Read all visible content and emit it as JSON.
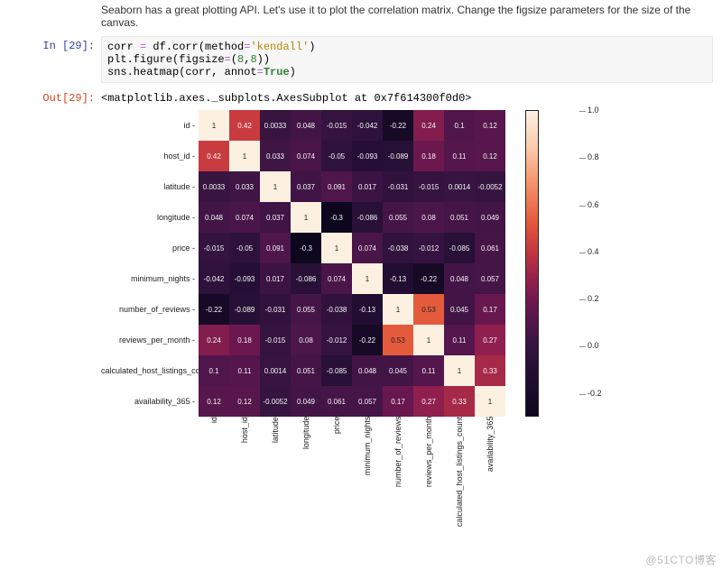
{
  "description": "Seaborn has a great plotting API. Let's use it to plot the correlation matrix. Change the figsize parameters for the size of the canvas.",
  "in_prompt": "In [29]:",
  "out_prompt": "Out[29]:",
  "code": {
    "l1a": "corr ",
    "l1b": "=",
    "l1c": " df.corr(method",
    "l1d": "=",
    "l1e": "'kendall'",
    "l1f": ")",
    "l2a": "plt.figure(figsize",
    "l2b": "=",
    "l2c": "(",
    "l2d": "8",
    "l2e": ",",
    "l2f": "8",
    "l2g": "))",
    "l3a": "sns.heatmap(corr, annot",
    "l3b": "=",
    "l3c": "True",
    "l3d": ")"
  },
  "output_text": "<matplotlib.axes._subplots.AxesSubplot at 0x7f614300f0d0>",
  "chart_data": {
    "type": "heatmap",
    "title": "",
    "labels": [
      "id",
      "host_id",
      "latitude",
      "longitude",
      "price",
      "minimum_nights",
      "number_of_reviews",
      "reviews_per_month",
      "calculated_host_listings_count",
      "availability_365"
    ],
    "annotations": [
      [
        "1",
        "0.42",
        "0.0033",
        "0.048",
        "-0.015",
        "-0.042",
        "-0.22",
        "0.24",
        "0.1",
        "0.12"
      ],
      [
        "0.42",
        "1",
        "0.033",
        "0.074",
        "-0.05",
        "-0.093",
        "-0.089",
        "0.18",
        "0.11",
        "0.12"
      ],
      [
        "0.0033",
        "0.033",
        "1",
        "0.037",
        "0.091",
        "0.017",
        "-0.031",
        "-0.015",
        "0.0014",
        "-0.0052"
      ],
      [
        "0.048",
        "0.074",
        "0.037",
        "1",
        "-0.3",
        "-0.086",
        "0.055",
        "0.08",
        "0.051",
        "0.049"
      ],
      [
        "-0.015",
        "-0.05",
        "0.091",
        "-0.3",
        "1",
        "0.074",
        "-0.038",
        "-0.012",
        "-0.085",
        "0.061"
      ],
      [
        "-0.042",
        "-0.093",
        "0.017",
        "-0.086",
        "0.074",
        "1",
        "-0.13",
        "-0.22",
        "0.048",
        "0.057"
      ],
      [
        "-0.22",
        "-0.089",
        "-0.031",
        "0.055",
        "-0.038",
        "-0.13",
        "1",
        "0.53",
        "0.045",
        "0.17"
      ],
      [
        "0.24",
        "0.18",
        "-0.015",
        "0.08",
        "-0.012",
        "-0.22",
        "0.53",
        "1",
        "0.11",
        "0.27"
      ],
      [
        "0.1",
        "0.11",
        "0.0014",
        "0.051",
        "-0.085",
        "0.048",
        "0.045",
        "0.11",
        "1",
        "0.33"
      ],
      [
        "0.12",
        "0.12",
        "-0.0052",
        "0.049",
        "0.061",
        "0.057",
        "0.17",
        "0.27",
        "0.33",
        "1"
      ]
    ],
    "values": [
      [
        1,
        0.42,
        0.0033,
        0.048,
        -0.015,
        -0.042,
        -0.22,
        0.24,
        0.1,
        0.12
      ],
      [
        0.42,
        1,
        0.033,
        0.074,
        -0.05,
        -0.093,
        -0.089,
        0.18,
        0.11,
        0.12
      ],
      [
        0.0033,
        0.033,
        1,
        0.037,
        0.091,
        0.017,
        -0.031,
        -0.015,
        0.0014,
        -0.0052
      ],
      [
        0.048,
        0.074,
        0.037,
        1,
        -0.3,
        -0.086,
        0.055,
        0.08,
        0.051,
        0.049
      ],
      [
        -0.015,
        -0.05,
        0.091,
        -0.3,
        1,
        0.074,
        -0.038,
        -0.012,
        -0.085,
        0.061
      ],
      [
        -0.042,
        -0.093,
        0.017,
        -0.086,
        0.074,
        1,
        -0.13,
        -0.22,
        0.048,
        0.057
      ],
      [
        -0.22,
        -0.089,
        -0.031,
        0.055,
        -0.038,
        -0.13,
        1,
        0.53,
        0.045,
        0.17
      ],
      [
        0.24,
        0.18,
        -0.015,
        0.08,
        -0.012,
        -0.22,
        0.53,
        1,
        0.11,
        0.27
      ],
      [
        0.1,
        0.11,
        0.0014,
        0.051,
        -0.085,
        0.048,
        0.045,
        0.11,
        1,
        0.33
      ],
      [
        0.12,
        0.12,
        -0.0052,
        0.049,
        0.061,
        0.057,
        0.17,
        0.27,
        0.33,
        1
      ]
    ],
    "colorbar": {
      "ticks": [
        "1.0",
        "0.8",
        "0.6",
        "0.4",
        "0.2",
        "0.0",
        "-0.2"
      ],
      "positions": [
        0.0,
        0.154,
        0.308,
        0.462,
        0.615,
        0.769,
        0.923
      ]
    }
  },
  "watermark": "@51CTO博客"
}
